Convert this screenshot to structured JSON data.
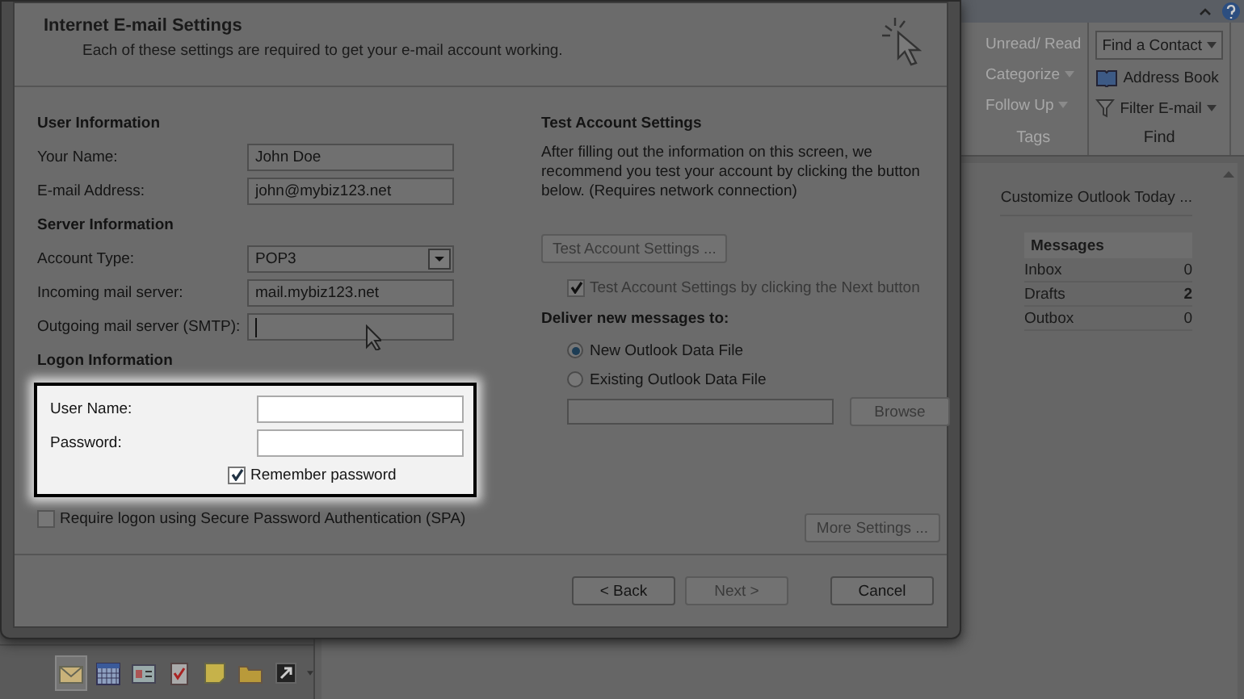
{
  "dialog": {
    "title": "Internet E-mail Settings",
    "subtitle": "Each of these settings are required to get your e-mail account working.",
    "user_info": {
      "heading": "User Information",
      "fields": [
        {
          "label": "Your Name:",
          "value": "John Doe"
        },
        {
          "label": "E-mail Address:",
          "value": "john@mybiz123.net"
        }
      ]
    },
    "server_info": {
      "heading": "Server Information",
      "account_type": {
        "label": "Account Type:",
        "value": "POP3"
      },
      "fields": [
        {
          "label": "Incoming mail server:",
          "value": "mail.mybiz123.net"
        },
        {
          "label": "Outgoing mail server (SMTP):",
          "focused": true
        }
      ]
    },
    "logon_info": {
      "heading": "Logon Information",
      "highlighted": true,
      "fields": [
        {
          "label": "User Name:"
        },
        {
          "label": "Password:"
        }
      ],
      "remember": {
        "label": "Remember password",
        "checked": true
      }
    },
    "spa": {
      "label": "Require logon using Secure Password Authentication (SPA)",
      "checked": false
    },
    "test_settings": {
      "heading": "Test Account Settings",
      "description": "After filling out the information on this screen, we recommend you test your account by clicking the button below. (Requires network connection)",
      "button": {
        "label": "Test Account Settings ...",
        "disabled": true
      },
      "auto_test": {
        "label": "Test Account Settings by clicking the Next button",
        "checked": true,
        "disabled": true
      }
    },
    "deliver": {
      "heading": "Deliver new messages to:",
      "options": [
        {
          "label": "New Outlook Data File",
          "selected": true
        },
        {
          "label": "Existing Outlook Data File",
          "selected": false
        }
      ],
      "browse": {
        "label": "Browse",
        "disabled": true
      }
    },
    "more_settings": {
      "label": "More Settings ...",
      "disabled": true
    },
    "buttons": [
      {
        "label": "< Back",
        "disabled": false
      },
      {
        "label": "Next >",
        "disabled": true
      },
      {
        "label": "Cancel",
        "disabled": false
      }
    ]
  },
  "ribbon": {
    "groups": [
      {
        "label": "Tags",
        "items": [
          {
            "label": "Unread/ Read",
            "kind": "text",
            "disabled": true
          },
          {
            "label": "Categorize",
            "kind": "menu",
            "disabled": true
          },
          {
            "label": "Follow Up",
            "kind": "menu",
            "disabled": true
          }
        ]
      },
      {
        "label": "Find",
        "items": [
          {
            "label": "Find a Contact",
            "kind": "combo",
            "disabled": false
          },
          {
            "label": "Address Book",
            "kind": "book",
            "disabled": false
          },
          {
            "label": "Filter E-mail",
            "kind": "filter",
            "disabled": false
          }
        ]
      }
    ]
  },
  "outlook_today": {
    "customize_link": "Customize Outlook Today ...",
    "messages": {
      "heading": "Messages",
      "rows": [
        {
          "name": "Inbox",
          "count": "0",
          "bold": false
        },
        {
          "name": "Drafts",
          "count": "2",
          "bold": true
        },
        {
          "name": "Outbox",
          "count": "0",
          "bold": false
        }
      ]
    }
  },
  "navbar": {
    "icons": [
      {
        "kind": "mail",
        "selected": true
      },
      {
        "kind": "calendar",
        "selected": false
      },
      {
        "kind": "contacts",
        "selected": false
      },
      {
        "kind": "tasks",
        "selected": false
      },
      {
        "kind": "notes",
        "selected": false
      },
      {
        "kind": "folder",
        "selected": false
      },
      {
        "kind": "shortcut",
        "selected": false
      }
    ]
  }
}
